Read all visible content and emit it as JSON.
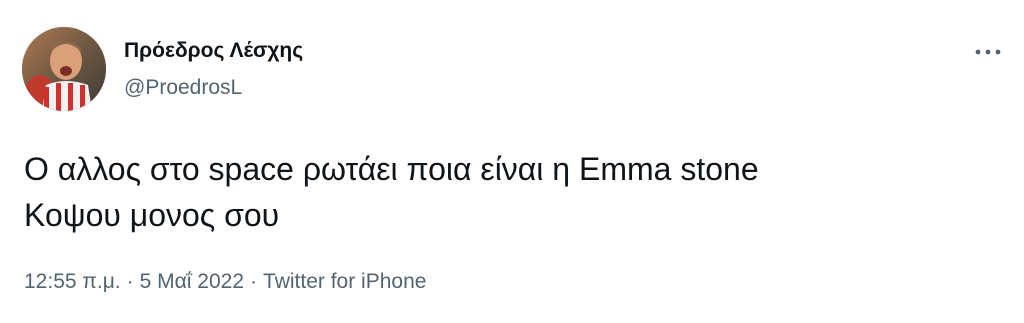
{
  "tweet": {
    "author": {
      "display_name": "Πρόεδρος Λέσχης",
      "handle": "@ProedrosL"
    },
    "text_lines": [
      "Ο αλλος στο space ρωτάει ποια είναι η Emma stone",
      "Κοψου μονος σου"
    ],
    "time": "12:55 π.μ.",
    "date": "5 Μαΐ 2022",
    "separator": "·",
    "source": "Twitter for iPhone",
    "icons": {
      "avatar": "profile-photo",
      "more": "more-dots-icon"
    },
    "colors": {
      "text": "#0f1419",
      "secondary": "#536471",
      "background": "#ffffff"
    }
  }
}
